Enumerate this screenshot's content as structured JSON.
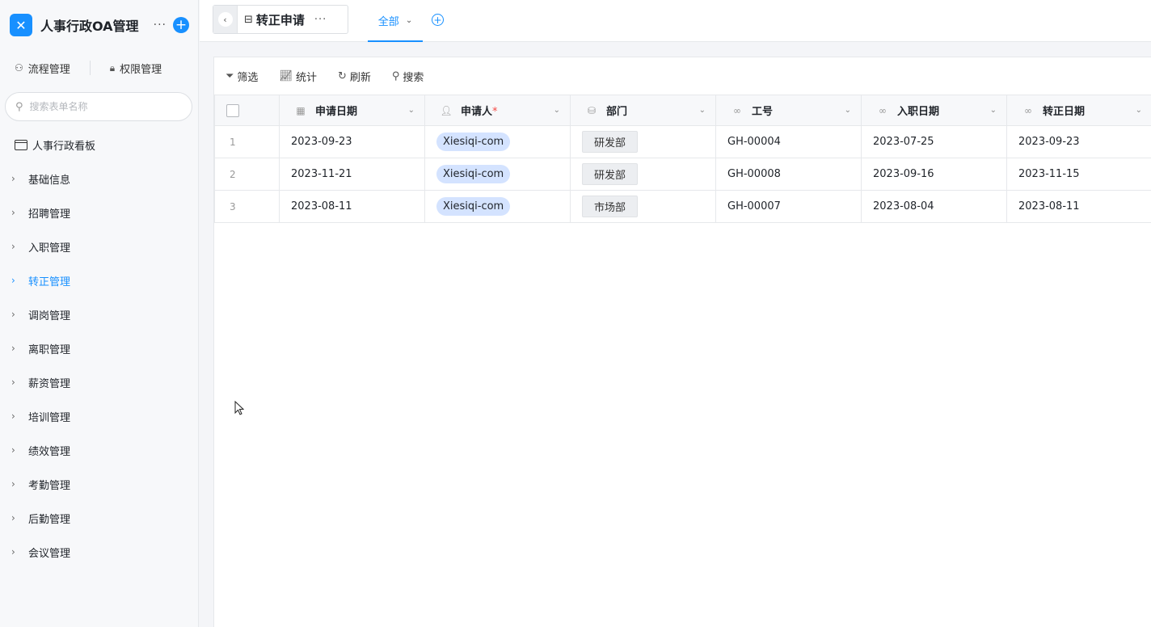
{
  "app": {
    "title": "人事行政OA管理",
    "more": "···",
    "add": "+"
  },
  "sidebar": {
    "tools": [
      {
        "label": "流程管理",
        "icon": "flow-icon"
      },
      {
        "label": "权限管理",
        "icon": "lock-icon"
      }
    ],
    "search": {
      "placeholder": "搜索表单名称",
      "value": ""
    },
    "dashboard": "人事行政看板",
    "items": [
      {
        "label": "基础信息",
        "active": false
      },
      {
        "label": "招聘管理",
        "active": false
      },
      {
        "label": "入职管理",
        "active": false
      },
      {
        "label": "转正管理",
        "active": true
      },
      {
        "label": "调岗管理",
        "active": false
      },
      {
        "label": "离职管理",
        "active": false
      },
      {
        "label": "薪资管理",
        "active": false
      },
      {
        "label": "培训管理",
        "active": false
      },
      {
        "label": "绩效管理",
        "active": false
      },
      {
        "label": "考勤管理",
        "active": false
      },
      {
        "label": "后勤管理",
        "active": false
      },
      {
        "label": "会议管理",
        "active": false
      }
    ]
  },
  "topbar": {
    "form_name": "转正申请",
    "form_more": "···",
    "view_tab": "全部"
  },
  "toolbar": {
    "filter": "筛选",
    "stats": "统计",
    "refresh": "刷新",
    "search": "搜索"
  },
  "table": {
    "columns": [
      {
        "label": "申请日期",
        "icon": "calendar-icon",
        "required": false
      },
      {
        "label": "申请人",
        "icon": "person-icon",
        "required": true
      },
      {
        "label": "部门",
        "icon": "database-icon",
        "required": false
      },
      {
        "label": "工号",
        "icon": "link-icon",
        "required": false
      },
      {
        "label": "入职日期",
        "icon": "link-icon",
        "required": false
      },
      {
        "label": "转正日期",
        "icon": "link-icon",
        "required": false
      }
    ],
    "required_mark": "*",
    "rows": [
      {
        "index": "1",
        "apply_date": "2023-09-23",
        "applicant": "Xiesiqi-com",
        "dept": "研发部",
        "emp_no": "GH-00004",
        "join_date": "2023-07-25",
        "regular_date": "2023-09-23"
      },
      {
        "index": "2",
        "apply_date": "2023-11-21",
        "applicant": "Xiesiqi-com",
        "dept": "研发部",
        "emp_no": "GH-00008",
        "join_date": "2023-09-16",
        "regular_date": "2023-11-15"
      },
      {
        "index": "3",
        "apply_date": "2023-08-11",
        "applicant": "Xiesiqi-com",
        "dept": "市场部",
        "emp_no": "GH-00007",
        "join_date": "2023-08-04",
        "regular_date": "2023-08-11"
      }
    ]
  },
  "colors": {
    "accent": "#1890ff",
    "chip": "#d4e3ff",
    "required": "#f54a45"
  }
}
